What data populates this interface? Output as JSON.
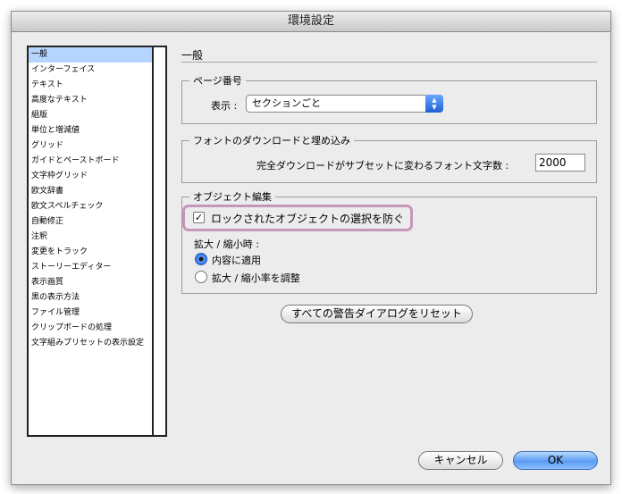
{
  "window": {
    "title": "環境設定"
  },
  "sidebar": {
    "items": [
      {
        "label": "一般",
        "selected": true
      },
      {
        "label": "インターフェイス"
      },
      {
        "label": "テキスト"
      },
      {
        "label": "高度なテキスト"
      },
      {
        "label": "組版"
      },
      {
        "label": "単位と増減値"
      },
      {
        "label": "グリッド"
      },
      {
        "label": "ガイドとペーストボード"
      },
      {
        "label": "文字枠グリッド"
      },
      {
        "label": "欧文辞書"
      },
      {
        "label": "欧文スペルチェック"
      },
      {
        "label": "自動修正"
      },
      {
        "label": "注釈"
      },
      {
        "label": "変更をトラック"
      },
      {
        "label": "ストーリーエディター"
      },
      {
        "label": "表示画質"
      },
      {
        "label": "黒の表示方法"
      },
      {
        "label": "ファイル管理"
      },
      {
        "label": "クリップボードの処理"
      },
      {
        "label": "文字組みプリセットの表示設定"
      }
    ]
  },
  "main": {
    "section_title": "一般",
    "page_numbering": {
      "group_label": "ページ番号",
      "view_label": "表示 :",
      "view_value": "セクションごと"
    },
    "font_download": {
      "group_label": "フォントのダウンロードと埋め込み",
      "threshold_label": "完全ダウンロードがサブセットに変わるフォント文字数 :",
      "threshold_value": "2000"
    },
    "object_editing": {
      "group_label": "オブジェクト編集",
      "prevent_selection_label": "ロックされたオブジェクトの選択を防ぐ",
      "prevent_selection_checked": true,
      "scaling_label": "拡大 / 縮小時 :",
      "apply_to_content_label": "内容に適用",
      "adjust_percentage_label": "拡大 / 縮小率を調整",
      "selected_option": "apply_to_content"
    },
    "reset_warnings_label": "すべての警告ダイアログをリセット"
  },
  "footer": {
    "cancel_label": "キャンセル",
    "ok_label": "OK"
  },
  "colors": {
    "accent": "#1e5fd6",
    "selection": "#b5d5ff",
    "highlight_ring": "#c596b8"
  }
}
